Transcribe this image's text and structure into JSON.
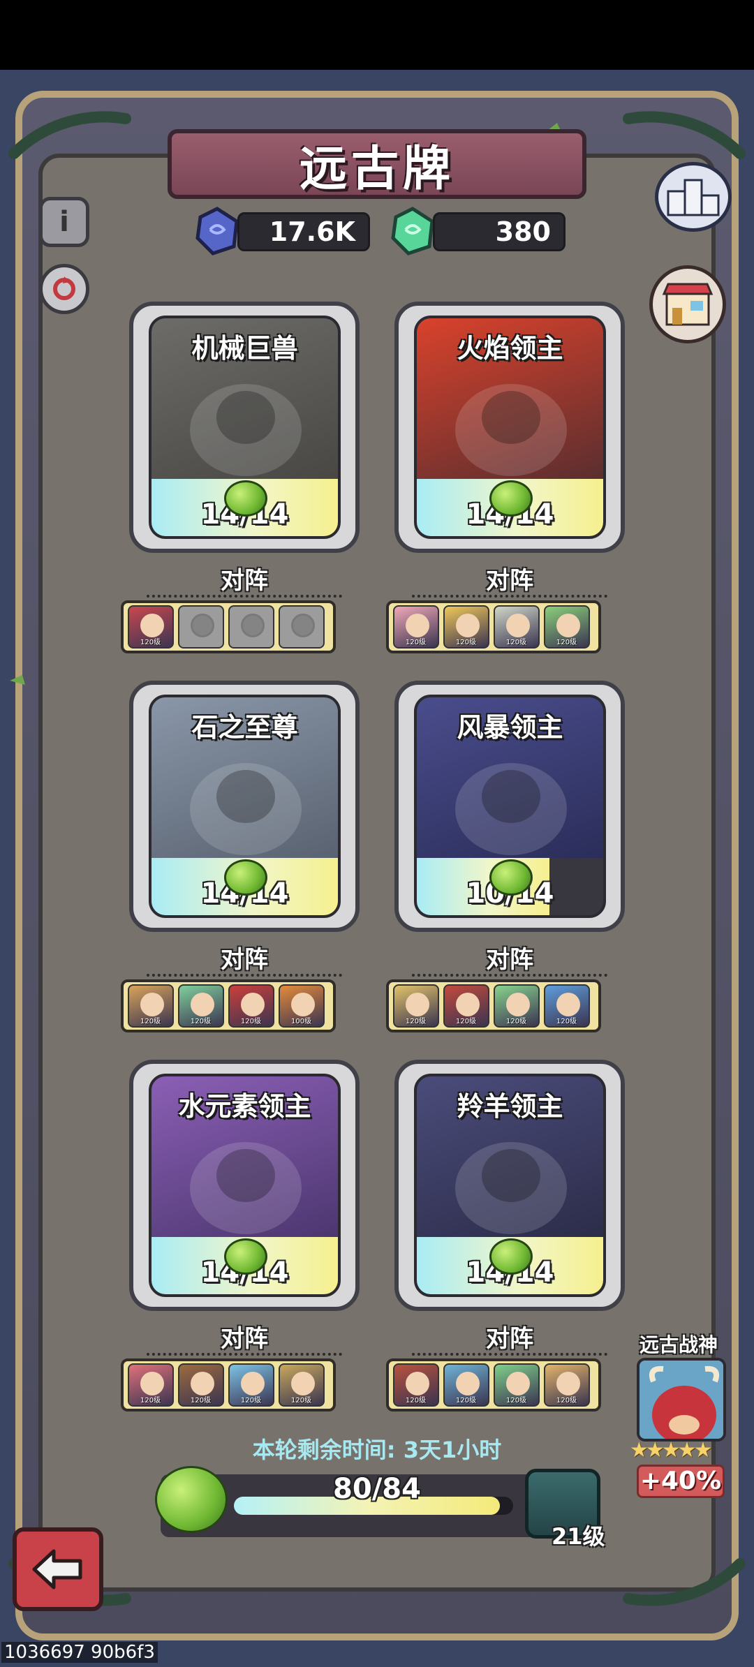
{
  "title": "远古牌",
  "currency": [
    {
      "icon": "blue-stone-icon",
      "value": "17.6K"
    },
    {
      "icon": "green-stone-icon",
      "value": "380"
    }
  ],
  "side_buttons": {
    "info_icon": "i",
    "refresh_icon": "refresh-icon",
    "ranking_icon": "podium-icon",
    "shop_icon": "shop-icon"
  },
  "lineup_label": "对阵",
  "cards": [
    {
      "name": "机械巨兽",
      "progress": "14/14",
      "fraction": 1.0,
      "art_colors": [
        "#6d6c68",
        "#3f3e3b"
      ],
      "lineup": [
        {
          "color": "#c9474f",
          "level": "120级",
          "empty": false
        },
        {
          "empty": true
        },
        {
          "empty": true
        },
        {
          "empty": true
        }
      ]
    },
    {
      "name": "火焰领主",
      "progress": "14/14",
      "fraction": 1.0,
      "art_colors": [
        "#d9422c",
        "#3b2930"
      ],
      "lineup": [
        {
          "color": "#f1a8b8",
          "level": "120级",
          "empty": false
        },
        {
          "color": "#f0c75a",
          "level": "120级",
          "empty": false
        },
        {
          "color": "#cfd7c8",
          "level": "120级",
          "empty": false
        },
        {
          "color": "#8bd07c",
          "level": "120级",
          "empty": false
        }
      ]
    },
    {
      "name": "石之至尊",
      "progress": "14/14",
      "fraction": 1.0,
      "art_colors": [
        "#8a97a8",
        "#4d5563"
      ],
      "lineup": [
        {
          "color": "#d9a45a",
          "level": "120级",
          "empty": false
        },
        {
          "color": "#7fcf9c",
          "level": "120级",
          "empty": false
        },
        {
          "color": "#cc3f3a",
          "level": "120级",
          "empty": false
        },
        {
          "color": "#e58b3b",
          "level": "100级",
          "empty": false
        }
      ]
    },
    {
      "name": "风暴领主",
      "progress": "10/14",
      "fraction": 0.714,
      "art_colors": [
        "#4a4d8c",
        "#23264d"
      ],
      "lineup": [
        {
          "color": "#e2c36a",
          "level": "120级",
          "empty": false
        },
        {
          "color": "#c24a3c",
          "level": "120级",
          "empty": false
        },
        {
          "color": "#88d38e",
          "level": "120级",
          "empty": false
        },
        {
          "color": "#5f9ddc",
          "level": "120级",
          "empty": false
        }
      ]
    },
    {
      "name": "水元素领主",
      "progress": "14/14",
      "fraction": 1.0,
      "art_colors": [
        "#8b5fb5",
        "#3c2c5e"
      ],
      "lineup": [
        {
          "color": "#e0717a",
          "level": "120级",
          "empty": false
        },
        {
          "color": "#9d6a3f",
          "level": "120级",
          "empty": false
        },
        {
          "color": "#7cc3e6",
          "level": "120级",
          "empty": false
        },
        {
          "color": "#c8a85b",
          "level": "120级",
          "empty": false
        }
      ]
    },
    {
      "name": "羚羊领主",
      "progress": "14/14",
      "fraction": 1.0,
      "art_colors": [
        "#4b4c7a",
        "#24253e"
      ],
      "lineup": [
        {
          "color": "#b8523e",
          "level": "120级",
          "empty": false
        },
        {
          "color": "#6fb3d6",
          "level": "120级",
          "empty": false
        },
        {
          "color": "#7fd08b",
          "level": "120级",
          "empty": false
        },
        {
          "color": "#e2b36a",
          "level": "120级",
          "empty": false
        }
      ]
    }
  ],
  "timer_text": "本轮剩余时间: 3天1小时",
  "progress_bar": {
    "text": "80/84",
    "fraction": 0.952,
    "level": "21级"
  },
  "ancient_god": {
    "label": "远古战神",
    "stars": "★★★★★",
    "bonus": "+40%"
  },
  "back_button_icon": "back-arrow-icon",
  "footer_id": "1036697 90b6f3"
}
